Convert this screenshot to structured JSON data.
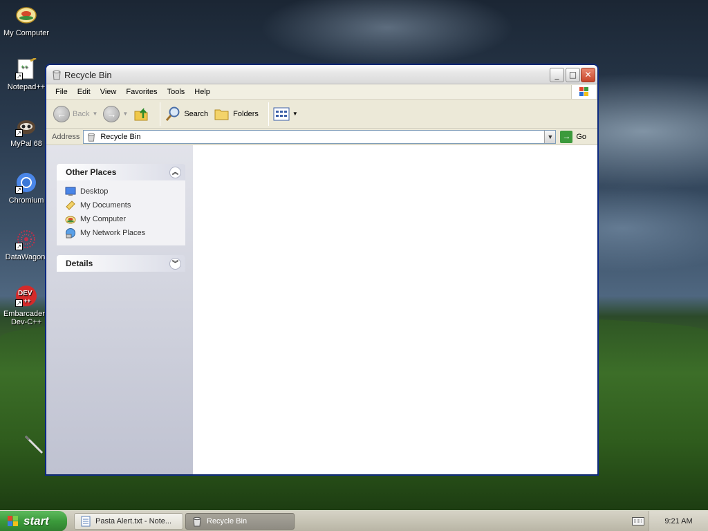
{
  "desktop": {
    "icons": [
      {
        "label": "My Computer"
      },
      {
        "label": "Notepad++"
      },
      {
        "label": "MyPal 68"
      },
      {
        "label": "Chromium"
      },
      {
        "label": "DataWagon."
      },
      {
        "label": "Embarcadero Dev-C++",
        "badge": "DEV",
        "badge_sub": "++"
      }
    ]
  },
  "window": {
    "title": "Recycle Bin",
    "controls": {
      "minimize": "_",
      "maximize": "□",
      "close": "✕"
    },
    "menu": [
      "File",
      "Edit",
      "View",
      "Favorites",
      "Tools",
      "Help"
    ],
    "toolbar": {
      "back": "Back",
      "search": "Search",
      "folders": "Folders"
    },
    "address": {
      "label": "Address",
      "value": "Recycle Bin",
      "go": "Go"
    },
    "taskpane": {
      "other_places": {
        "title": "Other Places",
        "items": [
          "Desktop",
          "My Documents",
          "My Computer",
          "My Network Places"
        ]
      },
      "details": {
        "title": "Details"
      }
    }
  },
  "taskbar": {
    "start": "start",
    "tasks": [
      "Pasta Alert.txt - Note...",
      "Recycle Bin"
    ],
    "clock": "9:21 AM"
  },
  "colors": {
    "title_text": "#222222",
    "close_button": "#c8452a",
    "start_green": "#3b9a3b",
    "taskpane_bg": "#d2d4de"
  }
}
